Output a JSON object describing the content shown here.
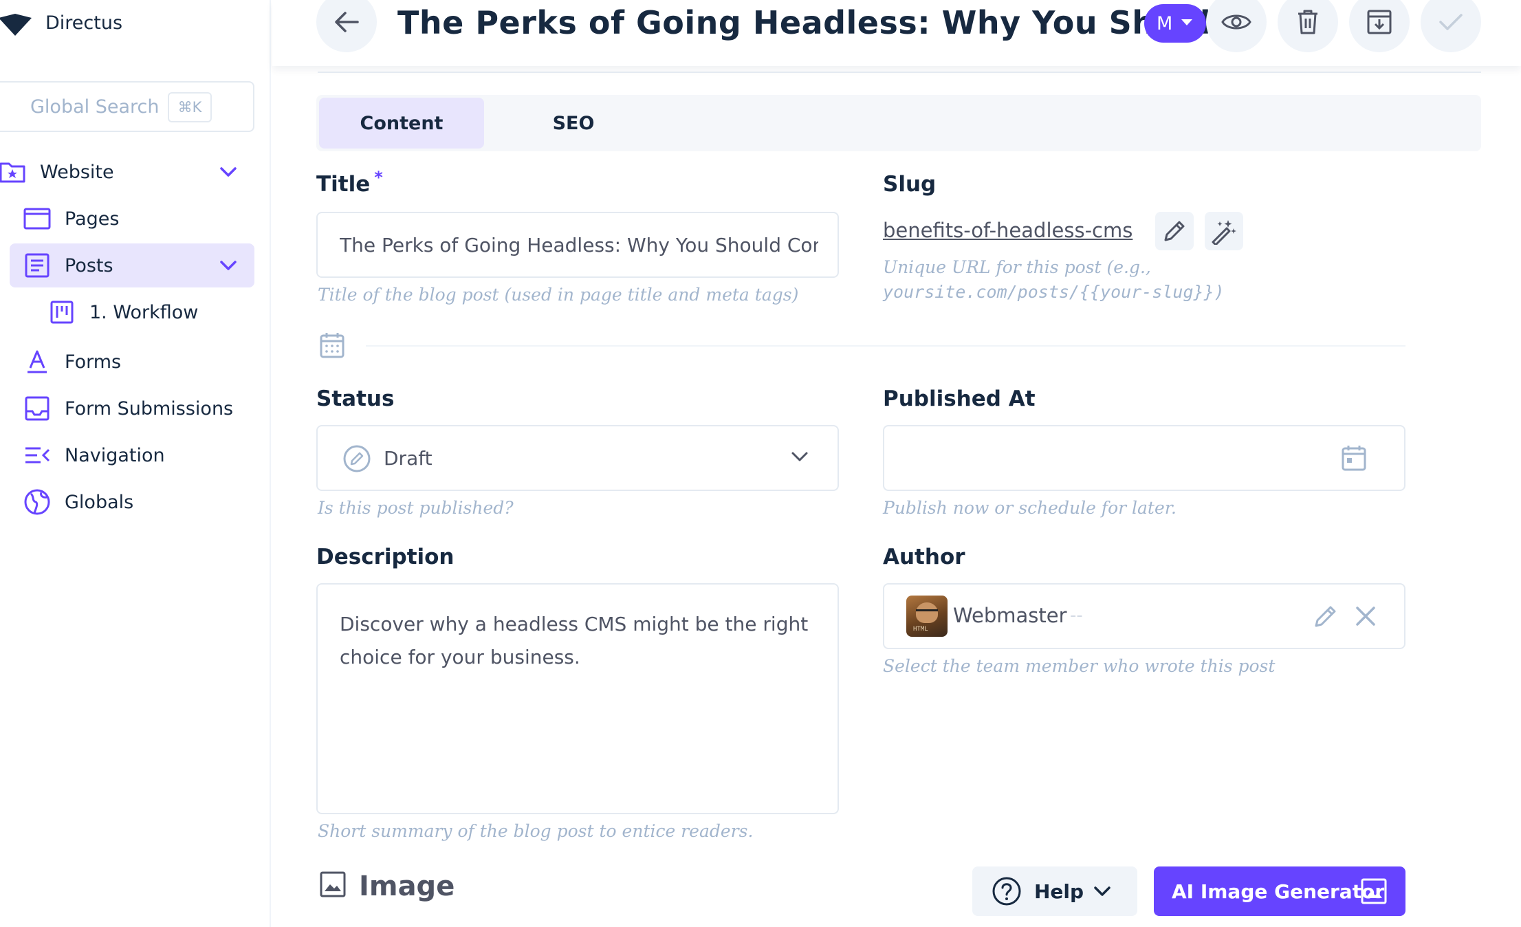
{
  "app": {
    "name": "Directus"
  },
  "search": {
    "placeholder": "Global Search",
    "shortcut": "⌘K"
  },
  "sidebar": {
    "items": [
      {
        "label": "Website",
        "icon": "folder-star-icon",
        "expanded": true
      },
      {
        "label": "Pages",
        "icon": "browser-window-icon"
      },
      {
        "label": "Posts",
        "icon": "article-icon",
        "active": true,
        "expanded": true
      },
      {
        "label": "1. Workflow",
        "icon": "kanban-icon"
      },
      {
        "label": "Forms",
        "icon": "format-text-icon"
      },
      {
        "label": "Form Submissions",
        "icon": "inbox-icon"
      },
      {
        "label": "Navigation",
        "icon": "menu-open-icon"
      },
      {
        "label": "Globals",
        "icon": "globe-icon"
      }
    ]
  },
  "header": {
    "title": "The Perks of Going Headless: Why You Should",
    "language_button": "M"
  },
  "tabs": [
    {
      "label": "Content",
      "active": true
    },
    {
      "label": "SEO",
      "active": false
    }
  ],
  "form": {
    "title": {
      "label": "Title",
      "required_mark": "*",
      "value": "The Perks of Going Headless: Why You Should Consider a Headless CMS",
      "hint": "Title of the blog post (used in page title and meta tags)"
    },
    "slug": {
      "label": "Slug",
      "value": "benefits-of-headless-cms",
      "hint_line1": "Unique URL for this post (e.g.,",
      "hint_line2": "yoursite.com/posts/{{your-slug}})"
    },
    "status": {
      "label": "Status",
      "value": "Draft",
      "hint": "Is this post published?"
    },
    "published_at": {
      "label": "Published At",
      "value": "",
      "hint": "Publish now or schedule for later."
    },
    "description": {
      "label": "Description",
      "value": "Discover why a headless CMS might be the right choice for your business.",
      "hint": "Short summary of the blog post to entice readers."
    },
    "author": {
      "label": "Author",
      "name": "Webmaster",
      "suffix": "--",
      "avatar_text": "HTML",
      "hint": "Select the team member who wrote this post"
    },
    "image": {
      "label": "Image",
      "help_label": "Help",
      "ai_button": "AI Image Generator"
    }
  },
  "colors": {
    "accent": "#6644ff",
    "accent_soft": "#e8e5fd",
    "text": "#172940",
    "muted": "#a2b5cd",
    "border": "#e4eaf1"
  }
}
